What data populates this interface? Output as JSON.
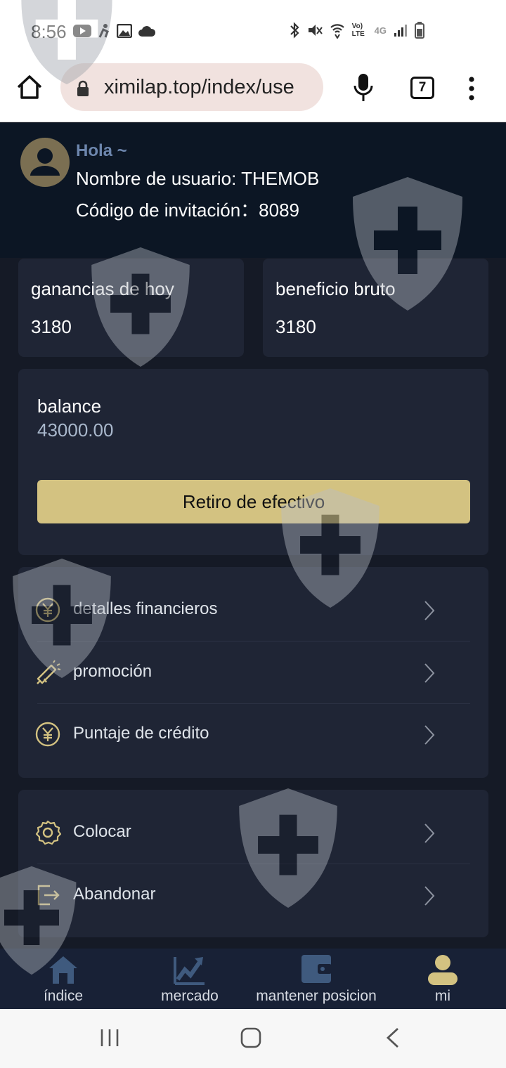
{
  "status_bar": {
    "time": "8:56",
    "network_label": "Vo) LTE",
    "network_gen": "4G"
  },
  "browser": {
    "url": "ximilap.top/index/use",
    "tab_count": "7"
  },
  "header": {
    "greeting": "Hola ~",
    "username": "Nombre de usuario: THEMOB",
    "invite_code": "Código de invitación：8089"
  },
  "stats": [
    {
      "label": "ganancias de hoy",
      "value": "3180"
    },
    {
      "label": "beneficio bruto",
      "value": "3180"
    }
  ],
  "balance": {
    "label": "balance",
    "value": "43000.00",
    "withdraw_label": "Retiro de efectivo"
  },
  "menu_group_1": [
    {
      "label": "detalles financieros",
      "icon": "yuan-coin-icon"
    },
    {
      "label": "promoción",
      "icon": "megaphone-icon"
    },
    {
      "label": "Puntaje de crédito",
      "icon": "yuan-coin-icon"
    }
  ],
  "menu_group_2": [
    {
      "label": "Colocar",
      "icon": "gear-icon"
    },
    {
      "label": "Abandonar",
      "icon": "logout-icon"
    }
  ],
  "bottom_nav": [
    {
      "label": "índice",
      "icon": "home-icon"
    },
    {
      "label": "mercado",
      "icon": "chart-icon"
    },
    {
      "label": "mantener posicion",
      "icon": "wallet-icon"
    },
    {
      "label": "mi",
      "icon": "user-icon"
    }
  ],
  "colors": {
    "accent_gold": "#d3c281",
    "header_bg": "#0c1624",
    "card_bg": "#1f2535",
    "page_bg": "#151a26",
    "active_nav": "#d3c281"
  }
}
